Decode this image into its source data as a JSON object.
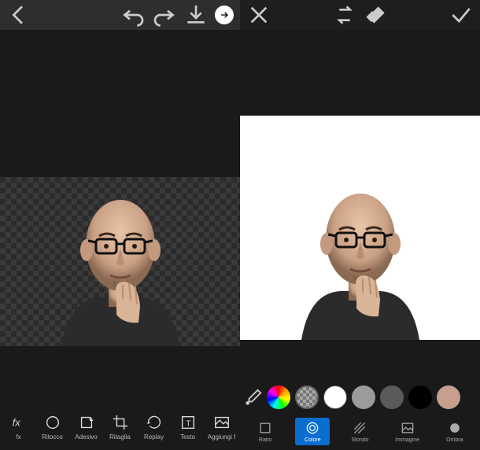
{
  "left": {
    "topbar": {
      "back": "back",
      "undo": "undo",
      "redo": "redo",
      "download": "download",
      "next": "next"
    },
    "tools": [
      {
        "id": "fx",
        "label": "fx"
      },
      {
        "id": "ritocco",
        "label": "Ritocco"
      },
      {
        "id": "adesivo",
        "label": "Adesivo"
      },
      {
        "id": "ritaglia",
        "label": "Ritaglia"
      },
      {
        "id": "replay",
        "label": "Replay"
      },
      {
        "id": "testo",
        "label": "Testo"
      },
      {
        "id": "aggiungi",
        "label": "Aggiungi f"
      }
    ]
  },
  "right": {
    "topbar": {
      "close": "close",
      "switch": "switch",
      "eraser": "eraser",
      "confirm": "confirm"
    },
    "swatches": [
      {
        "id": "rainbow",
        "type": "rainbow"
      },
      {
        "id": "transparent",
        "type": "checker"
      },
      {
        "id": "white",
        "type": "solid",
        "color": "#ffffff"
      },
      {
        "id": "gray-light",
        "type": "solid",
        "color": "#9b9b9b"
      },
      {
        "id": "gray-dark",
        "type": "solid",
        "color": "#5a5a5a"
      },
      {
        "id": "black",
        "type": "solid",
        "color": "#000000"
      },
      {
        "id": "tan",
        "type": "solid",
        "color": "#c69f8f"
      }
    ],
    "tabs": [
      {
        "id": "ratio",
        "label": "Ratio",
        "selected": false
      },
      {
        "id": "colore",
        "label": "Colore",
        "selected": true
      },
      {
        "id": "sfondo",
        "label": "Sfondo",
        "selected": false
      },
      {
        "id": "immagine",
        "label": "Immagine",
        "selected": false
      },
      {
        "id": "ombra",
        "label": "Ombra",
        "selected": false
      }
    ]
  },
  "colors": {
    "accent": "#0a6ed1",
    "panel": "#1a1a1a",
    "topbar": "#2e2e2e"
  }
}
